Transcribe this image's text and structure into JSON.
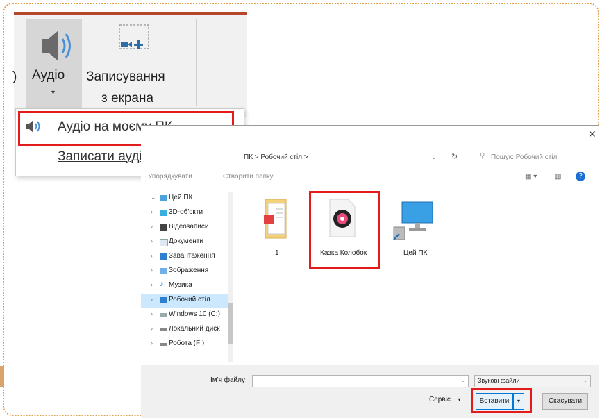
{
  "ribbon": {
    "audio_label": "Аудіо",
    "screen_recording_line1": "Записування",
    "screen_recording_line2": "з екрана"
  },
  "audio_menu": {
    "items": [
      {
        "label": "Аудіо на моєму ПК..."
      },
      {
        "label": "Записати аудіо..."
      }
    ]
  },
  "dialog": {
    "breadcrumb": "ПК  >  Робочий стіл  >",
    "search_placeholder": "Пошук: Робочий стіл",
    "organize_label": "Упорядкувати",
    "new_folder_label": "Створити папку",
    "tree": [
      {
        "label": "Цей ПК",
        "icon": "pc-icon"
      },
      {
        "label": "3D-об'єкти",
        "icon": "cube-icon"
      },
      {
        "label": "Відеозаписи",
        "icon": "video-icon"
      },
      {
        "label": "Документи",
        "icon": "document-icon"
      },
      {
        "label": "Завантаження",
        "icon": "download-icon"
      },
      {
        "label": "Зображення",
        "icon": "image-icon"
      },
      {
        "label": "Музика",
        "icon": "music-icon"
      },
      {
        "label": "Робочий стіл",
        "icon": "desktop-icon"
      },
      {
        "label": "Windows 10 (C:)",
        "icon": "drive-icon"
      },
      {
        "label": "Локальний диск",
        "icon": "drive-icon"
      },
      {
        "label": "Робота (F:)",
        "icon": "drive-icon"
      }
    ],
    "files": [
      {
        "name": "1",
        "icon": "pdf-folder-icon"
      },
      {
        "name": "Казка Колобок",
        "icon": "audio-file-icon"
      },
      {
        "name": "Цей ПК",
        "icon": "pc-shortcut-icon"
      }
    ],
    "filename_label": "Ім'я файлу:",
    "filename_value": "",
    "file_type": "Звукові файли",
    "service_label": "Сервіс",
    "insert_label": "Вставити",
    "cancel_label": "Скасувати"
  },
  "colors": {
    "highlight_red": "#e31b1b",
    "frame_dotted": "#e0a14a",
    "ribbon_accent": "#b7472a"
  }
}
